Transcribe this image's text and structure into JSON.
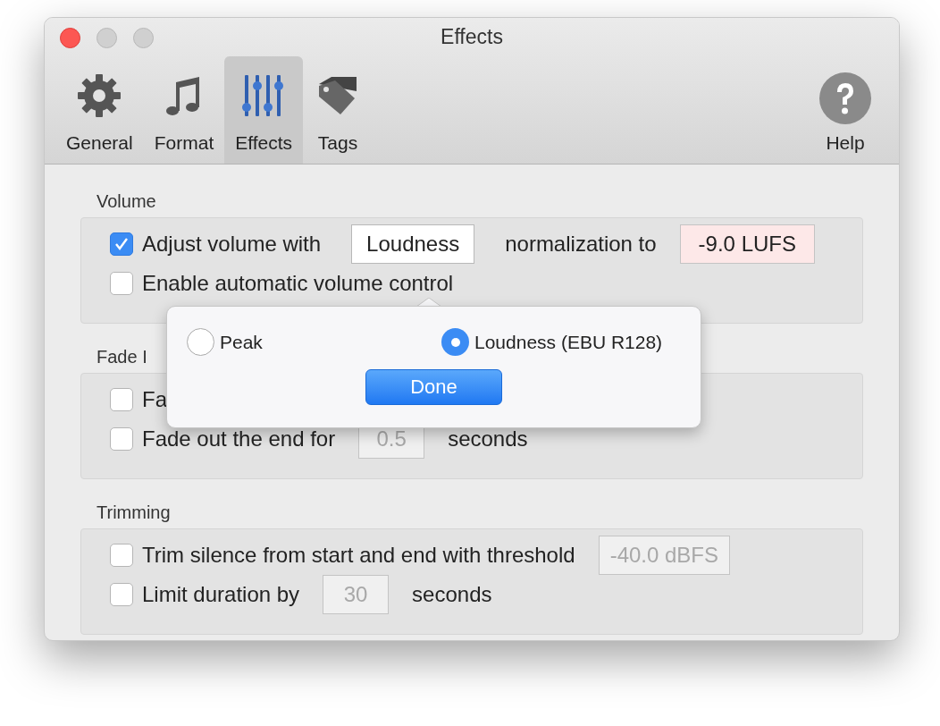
{
  "window": {
    "title": "Effects"
  },
  "toolbar": {
    "items": [
      {
        "label": "General",
        "kind": "gear",
        "selected": false
      },
      {
        "label": "Format",
        "kind": "note",
        "selected": false
      },
      {
        "label": "Effects",
        "kind": "sliders",
        "selected": true
      },
      {
        "label": "Tags",
        "kind": "tag",
        "selected": false
      }
    ],
    "help": "Help"
  },
  "sections": [
    {
      "title": "Volume",
      "rows": [
        {
          "checked": true,
          "parts": [
            {
              "kind": "text",
              "text": "Adjust volume with"
            },
            {
              "kind": "popup",
              "text": "Loudness"
            },
            {
              "kind": "text",
              "text": "normalization to"
            },
            {
              "kind": "field",
              "text": "-9.0 LUFS",
              "invalid": true,
              "disabled": false
            }
          ]
        },
        {
          "checked": false,
          "parts": [
            {
              "kind": "text",
              "text": "Enable automatic volume control"
            }
          ]
        }
      ]
    },
    {
      "title": "Fade I",
      "rows": [
        {
          "checked": false,
          "parts": [
            {
              "kind": "text",
              "text": "Fa"
            }
          ]
        },
        {
          "checked": false,
          "parts": [
            {
              "kind": "text",
              "text": "Fade out the end for"
            },
            {
              "kind": "field",
              "text": "0.5",
              "invalid": false,
              "disabled": true
            },
            {
              "kind": "text",
              "text": "seconds"
            }
          ]
        }
      ]
    },
    {
      "title": "Trimming",
      "rows": [
        {
          "checked": false,
          "parts": [
            {
              "kind": "text",
              "text": "Trim silence from start and end with threshold"
            },
            {
              "kind": "field",
              "text": "-40.0 dBFS",
              "invalid": false,
              "disabled": true
            }
          ]
        },
        {
          "checked": false,
          "parts": [
            {
              "kind": "text",
              "text": "Limit duration by"
            },
            {
              "kind": "field",
              "text": "30",
              "invalid": false,
              "disabled": true
            },
            {
              "kind": "text",
              "text": "seconds"
            }
          ]
        }
      ]
    }
  ],
  "popover": {
    "options": [
      {
        "label": "Peak",
        "selected": false
      },
      {
        "label": "Loudness (EBU R128)",
        "selected": true
      }
    ],
    "button": "Done"
  }
}
